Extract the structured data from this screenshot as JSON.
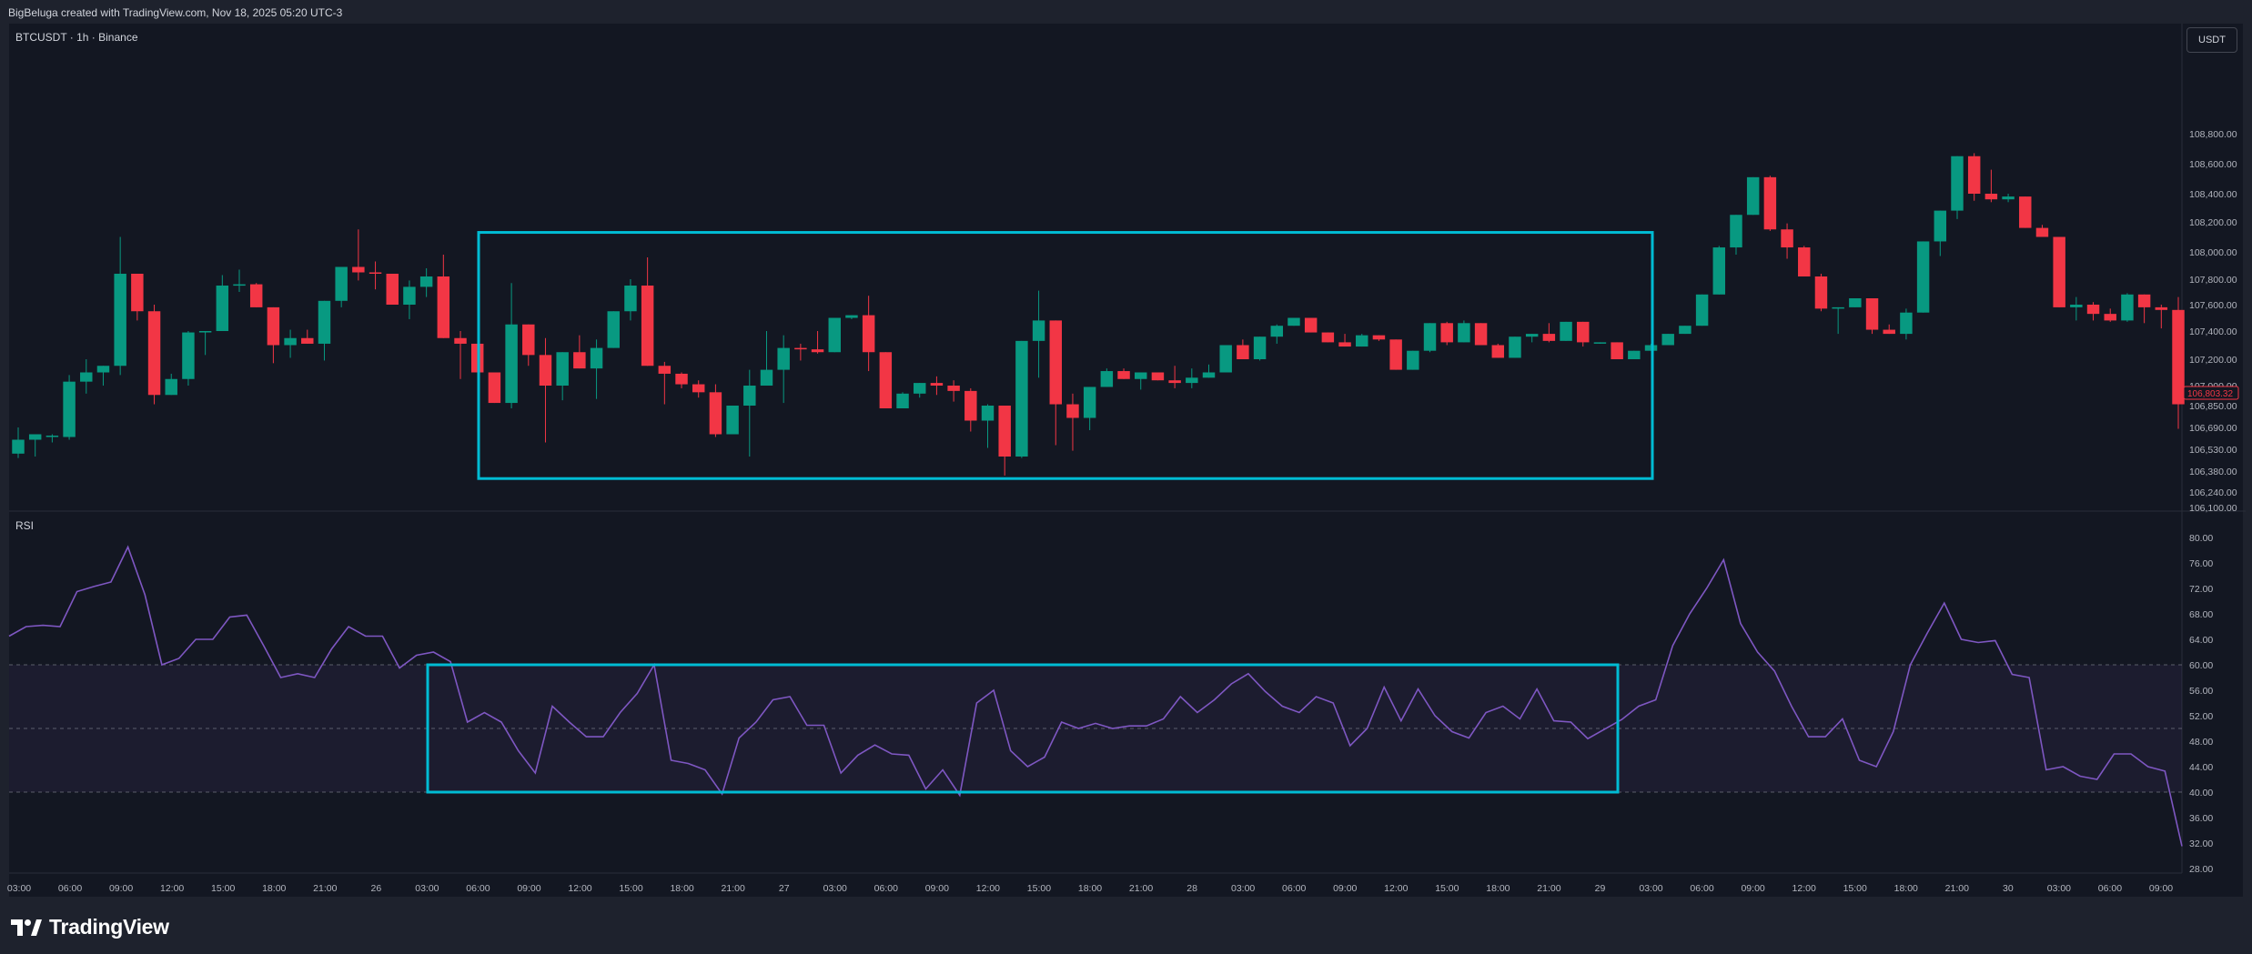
{
  "header": {
    "attribution": "BigBeluga created with TradingView.com, Nov 18, 2025 05:20 UTC-3"
  },
  "symbol_label": "BTCUSDT · 1h · Binance",
  "currency_button": "USDT",
  "rsi_label": "RSI",
  "footer": {
    "brand": "TradingView"
  },
  "colors": {
    "up": "#089981",
    "down": "#f23645",
    "rsi_line": "#7e57c2",
    "box": "#00bcd4",
    "background": "#131722"
  },
  "chart_data": [
    {
      "type": "candlestick",
      "title": "BTCUSDT · 1h · Binance",
      "price_ticks": [
        106100,
        106240,
        106380,
        106530,
        106690,
        106850,
        107000,
        107200,
        107400,
        107600,
        107800,
        108000,
        108200,
        108400,
        108600,
        108800
      ],
      "price_tick_labels": [
        "106,100.00",
        "106,240.00",
        "106,380.00",
        "106,530.00",
        "106,690.00",
        "106,850.00",
        "107,000.00",
        "107,200.00",
        "107,400.00",
        "107,600.00",
        "107,800.00",
        "108,000.00",
        "108,200.00",
        "108,400.00",
        "108,600.00",
        "108,800.00"
      ],
      "last_price_label": "106,803.32",
      "x_tick_labels": [
        "03:00",
        "06:00",
        "09:00",
        "12:00",
        "15:00",
        "18:00",
        "21:00",
        "26",
        "03:00",
        "06:00",
        "09:00",
        "12:00",
        "15:00",
        "18:00",
        "21:00",
        "27",
        "03:00",
        "06:00",
        "09:00",
        "12:00",
        "15:00",
        "18:00",
        "21:00",
        "28",
        "03:00",
        "06:00",
        "09:00",
        "12:00",
        "15:00",
        "18:00",
        "21:00",
        "29",
        "03:00",
        "06:00",
        "09:00",
        "12:00",
        "15:00",
        "18:00",
        "21:00",
        "30",
        "03:00",
        "06:00",
        "09:00"
      ],
      "candles_ohlc": [
        [
          106500,
          106690,
          106470,
          106600
        ],
        [
          106600,
          106620,
          106480,
          106640
        ],
        [
          106620,
          106640,
          106580,
          106630
        ],
        [
          106620,
          107080,
          106600,
          107030
        ],
        [
          107030,
          107200,
          106940,
          107100
        ],
        [
          107100,
          107130,
          107000,
          107150
        ],
        [
          107150,
          108100,
          107080,
          107840
        ],
        [
          107840,
          107840,
          107480,
          107550
        ],
        [
          107550,
          107600,
          106860,
          106930
        ],
        [
          106930,
          107090,
          106940,
          107050
        ],
        [
          107050,
          107400,
          107000,
          107390
        ],
        [
          107390,
          107380,
          107230,
          107400
        ],
        [
          107400,
          107830,
          107400,
          107750
        ],
        [
          107750,
          107870,
          107700,
          107760
        ],
        [
          107760,
          107770,
          107640,
          107580
        ],
        [
          107580,
          107580,
          107170,
          107300
        ],
        [
          107300,
          107410,
          107210,
          107350
        ],
        [
          107350,
          107410,
          107350,
          107310
        ],
        [
          107310,
          107590,
          107190,
          107630
        ],
        [
          107630,
          107810,
          107580,
          107890
        ],
        [
          107890,
          108150,
          107790,
          107850
        ],
        [
          107850,
          107930,
          107720,
          107840
        ],
        [
          107840,
          107800,
          107850,
          107600
        ],
        [
          107600,
          107790,
          107490,
          107740
        ],
        [
          107740,
          107880,
          107660,
          107820
        ],
        [
          107820,
          107980,
          107530,
          107350
        ],
        [
          107350,
          107400,
          107050,
          107310
        ],
        [
          107310,
          107200,
          107110,
          107100
        ],
        [
          107100,
          106960,
          106900,
          106870
        ],
        [
          106870,
          107770,
          106830,
          107450
        ],
        [
          107450,
          107450,
          107150,
          107230
        ],
        [
          107230,
          107350,
          106580,
          107000
        ],
        [
          107000,
          107160,
          106890,
          107250
        ],
        [
          107250,
          107370,
          107230,
          107130
        ],
        [
          107130,
          107340,
          106900,
          107280
        ],
        [
          107280,
          107480,
          107300,
          107550
        ],
        [
          107550,
          107800,
          107480,
          107750
        ],
        [
          107750,
          107960,
          107580,
          107150
        ],
        [
          107150,
          107180,
          106860,
          107090
        ],
        [
          107090,
          107100,
          106980,
          107010
        ],
        [
          107010,
          107040,
          106910,
          106950
        ],
        [
          106950,
          107010,
          106620,
          106640
        ],
        [
          106640,
          106690,
          106690,
          106850
        ],
        [
          106850,
          107120,
          106480,
          107000
        ],
        [
          107000,
          107400,
          107380,
          107120
        ],
        [
          107120,
          107370,
          106870,
          107280
        ],
        [
          107280,
          107310,
          107190,
          107270
        ],
        [
          107270,
          107400,
          107240,
          107250
        ],
        [
          107250,
          107400,
          107310,
          107500
        ],
        [
          107500,
          107520,
          107490,
          107520
        ],
        [
          107520,
          107670,
          107110,
          107250
        ],
        [
          107250,
          107220,
          106840,
          106830
        ],
        [
          106830,
          106950,
          106850,
          106940
        ],
        [
          106940,
          107000,
          106910,
          107020
        ],
        [
          107020,
          107070,
          106930,
          107000
        ],
        [
          107000,
          107040,
          106880,
          106960
        ],
        [
          106960,
          106980,
          106660,
          106740
        ],
        [
          106740,
          106860,
          106540,
          106850
        ],
        [
          106850,
          106820,
          106350,
          106480
        ],
        [
          106480,
          107270,
          106470,
          107330
        ],
        [
          107330,
          107710,
          107060,
          107480
        ],
        [
          107480,
          107450,
          106560,
          106860
        ],
        [
          106860,
          106940,
          106520,
          106760
        ],
        [
          106760,
          106880,
          106670,
          106990
        ],
        [
          106990,
          107130,
          106990,
          107110
        ],
        [
          107110,
          107130,
          107050,
          107050
        ],
        [
          107050,
          107100,
          106970,
          107100
        ],
        [
          107100,
          107100,
          107040,
          107040
        ],
        [
          107040,
          107150,
          106980,
          107020
        ],
        [
          107020,
          107130,
          106980,
          107060
        ],
        [
          107060,
          107160,
          107080,
          107100
        ],
        [
          107100,
          107250,
          107100,
          107300
        ],
        [
          107300,
          107340,
          107200,
          107200
        ],
        [
          107200,
          107350,
          107190,
          107360
        ],
        [
          107360,
          107450,
          107310,
          107440
        ],
        [
          107440,
          107500,
          107440,
          107500
        ],
        [
          107500,
          107500,
          107430,
          107390
        ],
        [
          107390,
          107380,
          107320,
          107320
        ],
        [
          107320,
          107380,
          107300,
          107290
        ],
        [
          107290,
          107380,
          107320,
          107370
        ],
        [
          107370,
          107370,
          107330,
          107340
        ],
        [
          107340,
          107320,
          107130,
          107120
        ],
        [
          107120,
          107250,
          107130,
          107260
        ],
        [
          107260,
          107450,
          107250,
          107460
        ],
        [
          107460,
          107470,
          107300,
          107320
        ],
        [
          107320,
          107480,
          107330,
          107460
        ],
        [
          107460,
          107460,
          107340,
          107300
        ],
        [
          107300,
          107310,
          107230,
          107210
        ],
        [
          107210,
          107340,
          107210,
          107360
        ],
        [
          107360,
          107360,
          107320,
          107380
        ],
        [
          107380,
          107460,
          107320,
          107330
        ],
        [
          107330,
          107470,
          107340,
          107470
        ],
        [
          107470,
          107460,
          107290,
          107320
        ],
        [
          107320,
          107320,
          107310,
          107320
        ],
        [
          107320,
          107320,
          107200,
          107200
        ],
        [
          107200,
          107210,
          107210,
          107260
        ],
        [
          107260,
          107310,
          107260,
          107300
        ],
        [
          107300,
          107340,
          107340,
          107380
        ],
        [
          107380,
          107390,
          107390,
          107440
        ],
        [
          107440,
          107670,
          107440,
          107680
        ],
        [
          107680,
          108040,
          107690,
          108030
        ],
        [
          108030,
          108200,
          107980,
          108250
        ],
        [
          108250,
          108500,
          108250,
          108510
        ],
        [
          108510,
          108520,
          108140,
          108150
        ],
        [
          108150,
          108190,
          107950,
          108030
        ],
        [
          108030,
          108040,
          107900,
          107820
        ],
        [
          107820,
          107840,
          107550,
          107570
        ],
        [
          107570,
          107580,
          107380,
          107580
        ],
        [
          107580,
          107570,
          107580,
          107650
        ],
        [
          107650,
          107650,
          107380,
          107410
        ],
        [
          107410,
          107450,
          107400,
          107380
        ],
        [
          107380,
          107570,
          107340,
          107540
        ],
        [
          107540,
          108070,
          107550,
          108070
        ],
        [
          108070,
          108270,
          107970,
          108280
        ],
        [
          108280,
          108590,
          108220,
          108650
        ],
        [
          108650,
          108670,
          108350,
          108400
        ],
        [
          108400,
          108560,
          108340,
          108360
        ],
        [
          108360,
          108400,
          108340,
          108380
        ],
        [
          108380,
          108380,
          108160,
          108160
        ],
        [
          108160,
          108180,
          108100,
          108100
        ],
        [
          108100,
          108100,
          107580,
          107580
        ],
        [
          107580,
          107660,
          107480,
          107600
        ],
        [
          107600,
          107620,
          107480,
          107530
        ],
        [
          107530,
          107570,
          107470,
          107480
        ],
        [
          107480,
          107690,
          107470,
          107680
        ],
        [
          107680,
          107680,
          107460,
          107580
        ],
        [
          107580,
          107600,
          107420,
          107560
        ],
        [
          107560,
          107660,
          106680,
          106860
        ]
      ],
      "highlight_box_price_range": [
        106330,
        108130
      ]
    },
    {
      "type": "line",
      "title": "RSI",
      "y_ticks": [
        28,
        32,
        36,
        40,
        44,
        48,
        52,
        56,
        60,
        64,
        68,
        72,
        76,
        80
      ],
      "y_tick_labels": [
        "28.00",
        "32.00",
        "36.00",
        "40.00",
        "44.00",
        "48.00",
        "52.00",
        "56.00",
        "60.00",
        "64.00",
        "68.00",
        "72.00",
        "76.00",
        "80.00"
      ],
      "bands": {
        "upper": 60,
        "middle": 50,
        "lower": 40
      },
      "values": [
        64.5,
        66,
        66.2,
        66,
        71.5,
        72.3,
        73,
        78.5,
        71,
        60,
        61,
        64,
        64,
        67.5,
        67.8,
        63,
        58,
        58.6,
        58,
        62.5,
        66,
        64.5,
        64.5,
        59.5,
        61.5,
        62,
        60.5,
        51,
        52.5,
        51,
        46.5,
        43,
        53.5,
        51,
        48.7,
        48.7,
        52.5,
        55.5,
        60,
        45,
        44.5,
        43.5,
        39.7,
        48.5,
        51,
        54.5,
        55,
        50.5,
        50.5,
        43,
        45.8,
        47.4,
        46,
        45.8,
        40.5,
        43.5,
        39.5,
        54,
        56,
        46.5,
        44,
        45.5,
        51,
        50,
        50.8,
        50,
        50.4,
        50.4,
        51.5,
        55,
        52.5,
        54.5,
        57,
        58.6,
        55.8,
        53.5,
        52.5,
        55,
        54,
        47.3,
        50,
        56.5,
        51.2,
        56.2,
        52,
        49.5,
        48.5,
        52.5,
        53.5,
        51.5,
        56.2,
        51.2,
        51,
        48.4,
        49.9,
        51.4,
        53.5,
        54.5,
        63,
        68,
        72,
        76.5,
        66.5,
        62,
        59,
        53.5,
        48.7,
        48.7,
        51.5,
        45,
        44,
        49.5,
        60,
        65,
        69.7,
        64,
        63.5,
        63.8,
        58.5,
        58,
        43.5,
        44,
        42.5,
        42,
        46,
        46,
        44,
        43.3,
        31.5
      ],
      "highlight_box_range": [
        40,
        60
      ]
    }
  ]
}
